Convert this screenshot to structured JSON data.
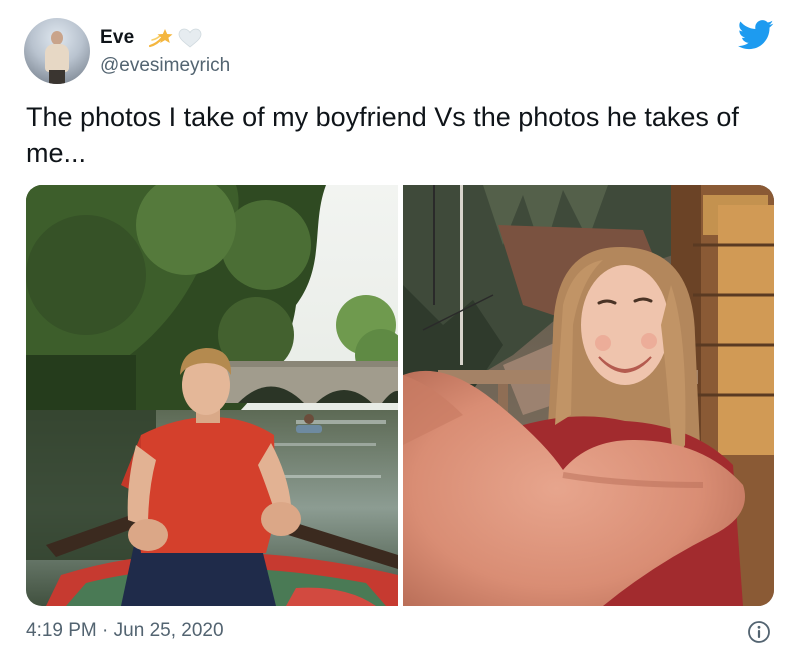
{
  "author": {
    "display_name": "Eve",
    "handle": "@evesimeyrich",
    "name_emojis": [
      "shooting-star-icon",
      "white-heart-icon"
    ]
  },
  "tweet": {
    "text": "The photos I take of my boyfriend Vs the photos he takes of me..."
  },
  "media": {
    "count": 2,
    "photos": [
      "photo-boyfriend-rowing",
      "photo-selfie-girlfriend"
    ]
  },
  "footer": {
    "time": "4:19 PM",
    "separator": "·",
    "date": "Jun 25, 2020"
  },
  "colors": {
    "twitter_blue": "#1d9bf0",
    "secondary_text": "#536471",
    "primary_text": "#0f1419"
  },
  "icons": {
    "brand": "twitter-bird-icon",
    "info": "info-icon"
  }
}
